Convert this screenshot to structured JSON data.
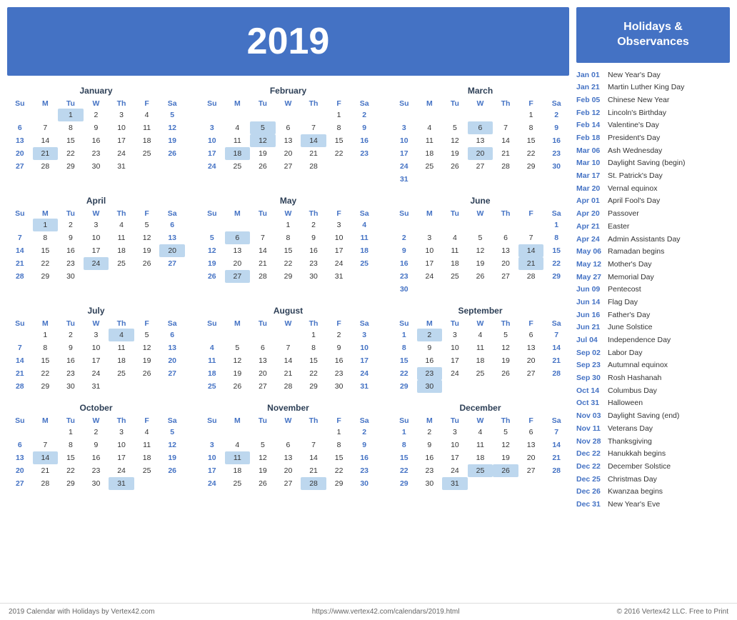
{
  "year": "2019",
  "calendar_title": "2019",
  "holidays_header": "Holidays &\nObservances",
  "months": [
    {
      "name": "January",
      "days_header": [
        "Su",
        "M",
        "Tu",
        "W",
        "Th",
        "F",
        "Sa"
      ],
      "weeks": [
        [
          null,
          null,
          "1h",
          "2",
          "3",
          "4",
          "5s"
        ],
        [
          "6s",
          "7",
          "8",
          "9",
          "10",
          "11",
          "12"
        ],
        [
          "13s",
          "14",
          "15",
          "16",
          "17",
          "18",
          "19"
        ],
        [
          "20s",
          "21h",
          "22",
          "23",
          "24",
          "25",
          "26"
        ],
        [
          "27s",
          "28",
          "29",
          "30",
          "31",
          null,
          null
        ]
      ]
    },
    {
      "name": "February",
      "days_header": [
        "Su",
        "M",
        "Tu",
        "W",
        "Th",
        "F",
        "Sa"
      ],
      "weeks": [
        [
          null,
          null,
          null,
          null,
          null,
          "1",
          "2"
        ],
        [
          "3s",
          "4",
          "5h",
          "6",
          "7",
          "8",
          "9"
        ],
        [
          "10s",
          "11",
          "12h",
          "13",
          "14h",
          "15",
          "16"
        ],
        [
          "17s",
          "18h",
          "19",
          "20",
          "21",
          "22",
          "23"
        ],
        [
          "24s",
          "25",
          "26",
          "27",
          "28",
          null,
          null
        ]
      ]
    },
    {
      "name": "March",
      "days_header": [
        "Su",
        "M",
        "Tu",
        "W",
        "Th",
        "F",
        "Sa"
      ],
      "weeks": [
        [
          null,
          null,
          null,
          null,
          null,
          "1",
          "2"
        ],
        [
          "3s",
          "4",
          "5",
          "6h",
          "7",
          "8",
          "9"
        ],
        [
          "10s",
          "11",
          "12",
          "13",
          "14",
          "15",
          "16"
        ],
        [
          "17s",
          "18",
          "19",
          "20h",
          "21",
          "22",
          "23"
        ],
        [
          "24s",
          "25",
          "26",
          "27",
          "28",
          "29",
          "30"
        ],
        [
          "31s",
          null,
          null,
          null,
          null,
          null,
          null
        ]
      ]
    },
    {
      "name": "April",
      "days_header": [
        "Su",
        "M",
        "Tu",
        "W",
        "Th",
        "F",
        "Sa"
      ],
      "weeks": [
        [
          null,
          "1h",
          "2",
          "3",
          "4",
          "5",
          "6s"
        ],
        [
          "7s",
          "8",
          "9",
          "10",
          "11",
          "12",
          "13"
        ],
        [
          "14s",
          "15",
          "16",
          "17",
          "18",
          "19",
          "20h"
        ],
        [
          "21s",
          "22",
          "23",
          "24h",
          "25",
          "26",
          "27"
        ],
        [
          "28s",
          "29",
          "30",
          null,
          null,
          null,
          null
        ]
      ]
    },
    {
      "name": "May",
      "days_header": [
        "Su",
        "M",
        "Tu",
        "W",
        "Th",
        "F",
        "Sa"
      ],
      "weeks": [
        [
          null,
          null,
          null,
          "1",
          "2",
          "3",
          "4s"
        ],
        [
          "5s",
          "6h",
          "7",
          "8",
          "9",
          "10",
          "11"
        ],
        [
          "12s",
          "13",
          "14",
          "15",
          "16",
          "17",
          "18"
        ],
        [
          "19s",
          "20",
          "21",
          "22",
          "23",
          "24",
          "25"
        ],
        [
          "26s",
          "27h",
          "28",
          "29",
          "30",
          "31",
          null
        ]
      ]
    },
    {
      "name": "June",
      "days_header": [
        "Su",
        "M",
        "Tu",
        "W",
        "Th",
        "F",
        "Sa"
      ],
      "weeks": [
        [
          null,
          null,
          null,
          null,
          null,
          null,
          "1s"
        ],
        [
          "2s",
          "3",
          "4",
          "5",
          "6",
          "7",
          "8"
        ],
        [
          "9s",
          "10",
          "11",
          "12",
          "13",
          "14h",
          "15"
        ],
        [
          "16s",
          "17",
          "18",
          "19",
          "20",
          "21h",
          "22"
        ],
        [
          "23s",
          "24",
          "25",
          "26",
          "27",
          "28",
          "29"
        ],
        [
          "30s",
          null,
          null,
          null,
          null,
          null,
          null
        ]
      ]
    },
    {
      "name": "July",
      "days_header": [
        "Su",
        "M",
        "Tu",
        "W",
        "Th",
        "F",
        "Sa"
      ],
      "weeks": [
        [
          null,
          "1",
          "2",
          "3",
          "4h",
          "5",
          "6s"
        ],
        [
          "7s",
          "8",
          "9",
          "10",
          "11",
          "12",
          "13"
        ],
        [
          "14s",
          "15",
          "16",
          "17",
          "18",
          "19",
          "20"
        ],
        [
          "21s",
          "22",
          "23",
          "24",
          "25",
          "26",
          "27"
        ],
        [
          "28s",
          "29",
          "30",
          "31",
          null,
          null,
          null
        ]
      ]
    },
    {
      "name": "August",
      "days_header": [
        "Su",
        "M",
        "Tu",
        "W",
        "Th",
        "F",
        "Sa"
      ],
      "weeks": [
        [
          null,
          null,
          null,
          null,
          "1",
          "2",
          "3s"
        ],
        [
          "4s",
          "5",
          "6",
          "7",
          "8",
          "9",
          "10"
        ],
        [
          "11s",
          "12",
          "13",
          "14",
          "15",
          "16",
          "17"
        ],
        [
          "18s",
          "19",
          "20",
          "21",
          "22",
          "23",
          "24"
        ],
        [
          "25s",
          "26",
          "27",
          "28",
          "29",
          "30",
          "31"
        ]
      ]
    },
    {
      "name": "September",
      "days_header": [
        "Su",
        "M",
        "Tu",
        "W",
        "Th",
        "F",
        "Sa"
      ],
      "weeks": [
        [
          "1s",
          "2h",
          "3",
          "4",
          "5",
          "6",
          "7"
        ],
        [
          "8s",
          "9",
          "10",
          "11",
          "12",
          "13",
          "14"
        ],
        [
          "15s",
          "16",
          "17",
          "18",
          "19",
          "20",
          "21"
        ],
        [
          "22s",
          "23h",
          "24",
          "25",
          "26",
          "27",
          "28"
        ],
        [
          "29s",
          "30h",
          null,
          null,
          null,
          null,
          null
        ]
      ]
    },
    {
      "name": "October",
      "days_header": [
        "Su",
        "M",
        "Tu",
        "W",
        "Th",
        "F",
        "Sa"
      ],
      "weeks": [
        [
          null,
          null,
          "1",
          "2",
          "3",
          "4",
          "5s"
        ],
        [
          "6s",
          "7",
          "8",
          "9",
          "10",
          "11",
          "12"
        ],
        [
          "13s",
          "14h",
          "15",
          "16",
          "17",
          "18",
          "19"
        ],
        [
          "20s",
          "21",
          "22",
          "23",
          "24",
          "25",
          "26"
        ],
        [
          "27s",
          "28",
          "29",
          "30",
          "31h",
          null,
          null
        ]
      ]
    },
    {
      "name": "November",
      "days_header": [
        "Su",
        "M",
        "Tu",
        "W",
        "Th",
        "F",
        "Sa"
      ],
      "weeks": [
        [
          null,
          null,
          null,
          null,
          null,
          "1",
          "2s"
        ],
        [
          "3s",
          "4",
          "5",
          "6",
          "7",
          "8",
          "9"
        ],
        [
          "10s",
          "11h",
          "12",
          "13",
          "14",
          "15",
          "16"
        ],
        [
          "17s",
          "18",
          "19",
          "20",
          "21",
          "22",
          "23"
        ],
        [
          "24s",
          "25",
          "26",
          "27",
          "28h",
          "29",
          "30"
        ]
      ]
    },
    {
      "name": "December",
      "days_header": [
        "Su",
        "M",
        "Tu",
        "W",
        "Th",
        "F",
        "Sa"
      ],
      "weeks": [
        [
          "1s",
          "2",
          "3",
          "4",
          "5",
          "6",
          "7"
        ],
        [
          "8s",
          "9",
          "10",
          "11",
          "12",
          "13",
          "14"
        ],
        [
          "15s",
          "16",
          "17",
          "18",
          "19",
          "20",
          "21"
        ],
        [
          "22s",
          "23",
          "24",
          "25h",
          "26h",
          "27",
          "28"
        ],
        [
          "29s",
          "30",
          "31h",
          null,
          null,
          null,
          null
        ]
      ]
    }
  ],
  "holidays": [
    {
      "date": "Jan 01",
      "name": "New Year's Day"
    },
    {
      "date": "Jan 21",
      "name": "Martin Luther King Day"
    },
    {
      "date": "Feb 05",
      "name": "Chinese New Year"
    },
    {
      "date": "Feb 12",
      "name": "Lincoln's Birthday"
    },
    {
      "date": "Feb 14",
      "name": "Valentine's Day"
    },
    {
      "date": "Feb 18",
      "name": "President's Day"
    },
    {
      "date": "Mar 06",
      "name": "Ash Wednesday"
    },
    {
      "date": "Mar 10",
      "name": "Daylight Saving (begin)"
    },
    {
      "date": "Mar 17",
      "name": "St. Patrick's Day"
    },
    {
      "date": "Mar 20",
      "name": "Vernal equinox"
    },
    {
      "date": "Apr 01",
      "name": "April Fool's Day"
    },
    {
      "date": "Apr 20",
      "name": "Passover"
    },
    {
      "date": "Apr 21",
      "name": "Easter"
    },
    {
      "date": "Apr 24",
      "name": "Admin Assistants Day"
    },
    {
      "date": "May 06",
      "name": "Ramadan begins"
    },
    {
      "date": "May 12",
      "name": "Mother's Day"
    },
    {
      "date": "May 27",
      "name": "Memorial Day"
    },
    {
      "date": "Jun 09",
      "name": "Pentecost"
    },
    {
      "date": "Jun 14",
      "name": "Flag Day"
    },
    {
      "date": "Jun 16",
      "name": "Father's Day"
    },
    {
      "date": "Jun 21",
      "name": "June Solstice"
    },
    {
      "date": "Jul 04",
      "name": "Independence Day"
    },
    {
      "date": "Sep 02",
      "name": "Labor Day"
    },
    {
      "date": "Sep 23",
      "name": "Autumnal equinox"
    },
    {
      "date": "Sep 30",
      "name": "Rosh Hashanah"
    },
    {
      "date": "Oct 14",
      "name": "Columbus Day"
    },
    {
      "date": "Oct 31",
      "name": "Halloween"
    },
    {
      "date": "Nov 03",
      "name": "Daylight Saving (end)"
    },
    {
      "date": "Nov 11",
      "name": "Veterans Day"
    },
    {
      "date": "Nov 28",
      "name": "Thanksgiving"
    },
    {
      "date": "Dec 22",
      "name": "Hanukkah begins"
    },
    {
      "date": "Dec 22",
      "name": "December Solstice"
    },
    {
      "date": "Dec 25",
      "name": "Christmas Day"
    },
    {
      "date": "Dec 26",
      "name": "Kwanzaa begins"
    },
    {
      "date": "Dec 31",
      "name": "New Year's Eve"
    }
  ],
  "footer": {
    "left": "2019 Calendar with Holidays by Vertex42.com",
    "center": "https://www.vertex42.com/calendars/2019.html",
    "right": "© 2016 Vertex42 LLC. Free to Print"
  }
}
